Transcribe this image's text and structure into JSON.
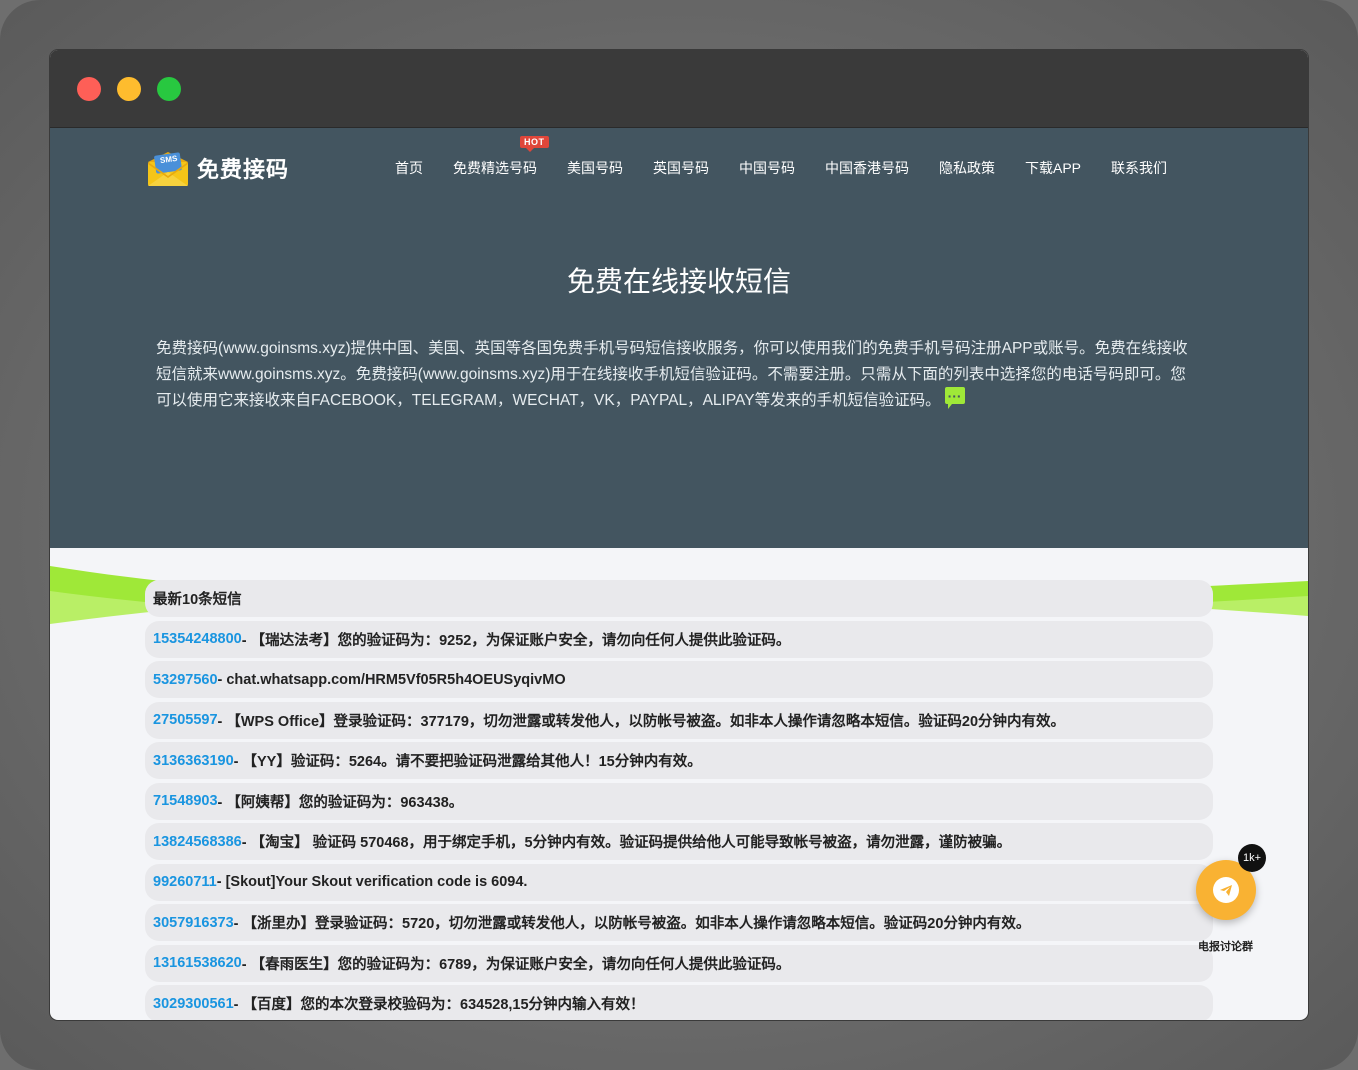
{
  "brand": {
    "name": "免费接码",
    "icon_text": "SMS"
  },
  "nav": {
    "items": [
      {
        "label": "首页"
      },
      {
        "label": "免费精选号码",
        "badge": "HOT"
      },
      {
        "label": "美国号码"
      },
      {
        "label": "英国号码"
      },
      {
        "label": "中国号码"
      },
      {
        "label": "中国香港号码"
      },
      {
        "label": "隐私政策"
      },
      {
        "label": "下载APP"
      },
      {
        "label": "联系我们"
      }
    ]
  },
  "hero": {
    "title": "免费在线接收短信",
    "description": "免费接码(www.goinsms.xyz)提供中国、美国、英国等各国免费手机号码短信接收服务，你可以使用我们的免费手机号码注册APP或账号。免费在线接收短信就来www.goinsms.xyz。免费接码(www.goinsms.xyz)用于在线接收手机短信验证码。不需要注册。只需从下面的列表中选择您的电话号码即可。您可以使用它来接收来自FACEBOOK，TELEGRAM，WECHAT，VK，PAYPAL，ALIPAY等发来的手机短信验证码。"
  },
  "messages": {
    "header": "最新10条短信",
    "items": [
      {
        "number": "15354248800",
        "text": "- 【瑞达法考】您的验证码为：9252，为保证账户安全，请勿向任何人提供此验证码。"
      },
      {
        "number": "53297560",
        "text": "- chat.whatsapp.com/HRM5Vf05R5h4OEUSyqivMO"
      },
      {
        "number": "27505597",
        "text": "- 【WPS Office】登录验证码：377179，切勿泄露或转发他人，以防帐号被盗。如非本人操作请忽略本短信。验证码20分钟内有效。"
      },
      {
        "number": "3136363190",
        "text": "- 【YY】验证码：5264。请不要把验证码泄露给其他人！15分钟内有效。"
      },
      {
        "number": "71548903",
        "text": "- 【阿姨帮】您的验证码为：963438。"
      },
      {
        "number": "13824568386",
        "text": "- 【淘宝】 验证码 570468，用于绑定手机，5分钟内有效。验证码提供给他人可能导致帐号被盗，请勿泄露，谨防被骗。"
      },
      {
        "number": "99260711",
        "text": "- [Skout]Your Skout verification code is 6094."
      },
      {
        "number": "3057916373",
        "text": "- 【浙里办】登录验证码：5720，切勿泄露或转发他人，以防帐号被盗。如非本人操作请忽略本短信。验证码20分钟内有效。"
      },
      {
        "number": "13161538620",
        "text": "- 【春雨医生】您的验证码为：6789，为保证账户安全，请勿向任何人提供此验证码。"
      },
      {
        "number": "3029300561",
        "text": "- 【百度】您的本次登录校验码为：634528,15分钟内输入有效！"
      }
    ]
  },
  "fab": {
    "count": "1k+",
    "label": "电报讨论群",
    "icon": "telegram-icon"
  },
  "colors": {
    "hero_bg": "#435560",
    "accent_green": "#9fe838",
    "number_blue": "#1a95e0",
    "fab_orange": "#f9b233"
  }
}
